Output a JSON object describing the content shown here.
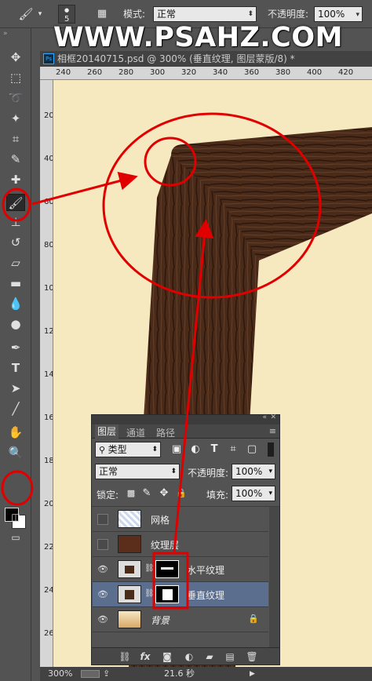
{
  "options_bar": {
    "brush_size": "5",
    "mode_label": "模式:",
    "mode_value": "正常",
    "opacity_label": "不透明度:",
    "opacity_value": "100%"
  },
  "watermark": "WWW.PSAHZ.COM",
  "document": {
    "tab_title": "相框20140715.psd @ 300% (垂直纹理, 图层蒙版/8) *",
    "ps_badge": "Ps",
    "ruler_h": [
      "240",
      "260",
      "280",
      "300",
      "320",
      "340",
      "360",
      "380",
      "400",
      "420"
    ],
    "ruler_v": [
      "20",
      "40",
      "60",
      "80",
      "100",
      "120",
      "140",
      "160",
      "180",
      "200",
      "220",
      "240",
      "260"
    ]
  },
  "status_bar": {
    "zoom": "300%",
    "info": "21.6 秒"
  },
  "layers_panel": {
    "tabs": [
      "图层",
      "通道",
      "路径"
    ],
    "filter_kind": "类型",
    "blend_mode": "正常",
    "opacity_label": "不透明度:",
    "opacity_value": "100%",
    "lock_label": "锁定:",
    "fill_label": "填充:",
    "fill_value": "100%",
    "layers": [
      {
        "name": "网格",
        "visible": false,
        "selected": false
      },
      {
        "name": "纹理层",
        "visible": false,
        "selected": false
      },
      {
        "name": "水平纹理",
        "visible": true,
        "selected": false
      },
      {
        "name": "垂直纹理",
        "visible": true,
        "selected": true
      },
      {
        "name": "背景",
        "visible": true,
        "selected": false
      }
    ],
    "footer_fx": "fx"
  },
  "colors": {
    "canvas_bg": "#f6e9c0",
    "wood": "#4a2a18",
    "annotation_red": "#e00000",
    "selected_layer": "#5c6e8e"
  }
}
